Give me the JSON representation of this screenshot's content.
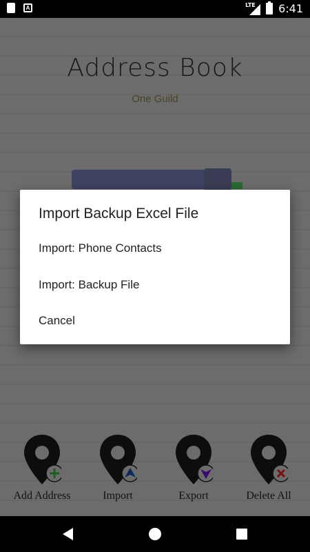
{
  "status_bar": {
    "time": "6:41",
    "network": "LTE"
  },
  "app": {
    "title": "Address Book",
    "subtitle": "One Guild"
  },
  "bottom_buttons": [
    {
      "label": "Add Address",
      "icon": "plus-icon",
      "color": "#2e7d32"
    },
    {
      "label": "Import",
      "icon": "arrow-up-icon",
      "color": "#1e3a8a"
    },
    {
      "label": "Export",
      "icon": "arrow-down-icon",
      "color": "#4a148c"
    },
    {
      "label": "Delete All",
      "icon": "close-icon",
      "color": "#b71c1c"
    }
  ],
  "dialog": {
    "title": "Import Backup Excel File",
    "items": [
      "Import: Phone Contacts",
      "Import: Backup File",
      "Cancel"
    ]
  }
}
